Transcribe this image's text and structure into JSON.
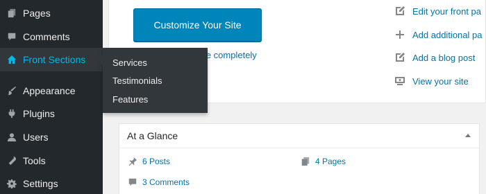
{
  "sidebar": {
    "items": [
      {
        "label": "Pages",
        "icon": "pages-icon"
      },
      {
        "label": "Comments",
        "icon": "comments-icon"
      },
      {
        "label": "Front Sections",
        "icon": "home-icon"
      },
      {
        "label": "Appearance",
        "icon": "appearance-icon"
      },
      {
        "label": "Plugins",
        "icon": "plugins-icon"
      },
      {
        "label": "Users",
        "icon": "users-icon"
      },
      {
        "label": "Tools",
        "icon": "tools-icon"
      },
      {
        "label": "Settings",
        "icon": "settings-icon"
      }
    ],
    "flyout": [
      "Services",
      "Testimonials",
      "Features"
    ]
  },
  "welcome": {
    "customize_label": "Customize Your Site",
    "dismiss_text": "me completely",
    "next_steps": [
      {
        "label": "Edit your front pa",
        "icon": "edit-icon"
      },
      {
        "label": "Add additional pa",
        "icon": "plus-icon"
      },
      {
        "label": "Add a blog post",
        "icon": "edit-icon"
      },
      {
        "label": "View your site",
        "icon": "view-site-icon"
      }
    ]
  },
  "glance": {
    "title": "At a Glance",
    "posts": "6 Posts",
    "pages": "4 Pages",
    "comments": "3 Comments"
  },
  "colors": {
    "sidebar_bg": "#23282d",
    "accent": "#00b9eb",
    "button": "#0085ba",
    "link": "#0073aa"
  }
}
